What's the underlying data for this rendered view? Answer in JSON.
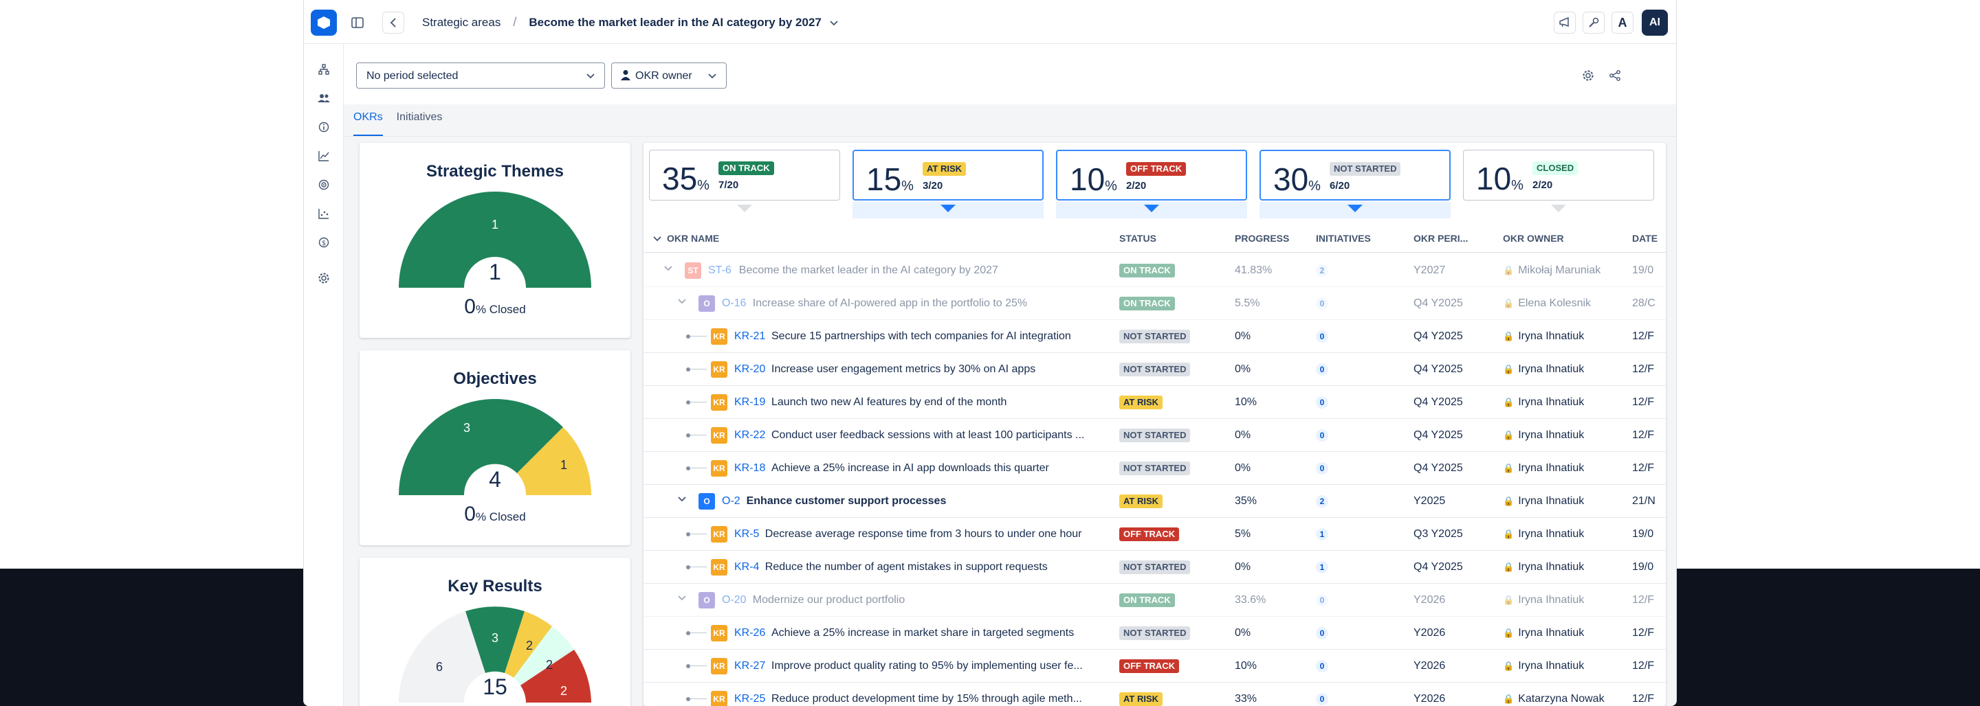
{
  "breadcrumb": {
    "parent": "Strategic areas",
    "current": "Become the market leader in the AI category by 2027"
  },
  "topbar": {
    "avatar_text": "AI",
    "font_icon_text": "A"
  },
  "filters": {
    "period": "No period selected",
    "owner": "OKR owner"
  },
  "tabs": [
    {
      "label": "OKRs"
    },
    {
      "label": "Initiatives"
    }
  ],
  "panels": {
    "themes": {
      "title": "Strategic Themes",
      "total": "1",
      "closed_value": "0",
      "closed_label": "% Closed",
      "segments": [
        {
          "label": "1",
          "value": 1,
          "color": "#1f845a"
        }
      ]
    },
    "objectives": {
      "title": "Objectives",
      "total": "4",
      "closed_value": "0",
      "closed_label": "% Closed",
      "segments": [
        {
          "label": "3",
          "value": 3,
          "color": "#1f845a"
        },
        {
          "label": "1",
          "value": 1,
          "color": "#f5cd47"
        }
      ]
    },
    "key_results": {
      "title": "Key Results",
      "total": "15",
      "segment_labels": [
        "6",
        "3",
        "2",
        "2",
        "2"
      ]
    }
  },
  "stats": [
    {
      "value": "35",
      "unit": "%",
      "badge": "ON TRACK",
      "fraction": "7/20"
    },
    {
      "value": "15",
      "unit": "%",
      "badge": "AT RISK",
      "fraction": "3/20"
    },
    {
      "value": "10",
      "unit": "%",
      "badge": "OFF TRACK",
      "fraction": "2/20"
    },
    {
      "value": "30",
      "unit": "%",
      "badge": "NOT STARTED",
      "fraction": "6/20"
    },
    {
      "value": "10",
      "unit": "%",
      "badge": "CLOSED",
      "fraction": "2/20"
    }
  ],
  "table": {
    "headers": {
      "name": "OKR NAME",
      "status": "STATUS",
      "progress": "PROGRESS",
      "initiatives": "INITIATIVES",
      "period": "OKR PERI...",
      "owner": "OKR OWNER",
      "date": "DATE"
    },
    "rows": [
      {
        "type": "ST",
        "id": "ST-6",
        "name": "Become the market leader in the AI category by 2027",
        "status": "ON TRACK",
        "progress": "41.83%",
        "initiatives": "2",
        "period": "Y2027",
        "owner": "Mikołaj Maruniak",
        "date": "19/0"
      },
      {
        "type": "O",
        "id": "O-16",
        "name": "Increase share of AI-powered app in the portfolio to 25%",
        "status": "ON TRACK",
        "progress": "5.5%",
        "initiatives": "0",
        "period": "Q4 Y2025",
        "owner": "Elena Kolesnik",
        "date": "28/C"
      },
      {
        "type": "KR",
        "id": "KR-21",
        "name": "Secure 15 partnerships with tech companies for AI integration",
        "status": "NOT STARTED",
        "progress": "0%",
        "initiatives": "0",
        "period": "Q4 Y2025",
        "owner": "Iryna Ihnatiuk",
        "date": "12/F"
      },
      {
        "type": "KR",
        "id": "KR-20",
        "name": "Increase user engagement metrics by 30% on AI apps",
        "status": "NOT STARTED",
        "progress": "0%",
        "initiatives": "0",
        "period": "Q4 Y2025",
        "owner": "Iryna Ihnatiuk",
        "date": "12/F"
      },
      {
        "type": "KR",
        "id": "KR-19",
        "name": "Launch two new AI features by end of the month",
        "status": "AT RISK",
        "progress": "10%",
        "initiatives": "0",
        "period": "Q4 Y2025",
        "owner": "Iryna Ihnatiuk",
        "date": "12/F"
      },
      {
        "type": "KR",
        "id": "KR-22",
        "name": "Conduct user feedback sessions with at least 100 participants ...",
        "status": "NOT STARTED",
        "progress": "0%",
        "initiatives": "0",
        "period": "Q4 Y2025",
        "owner": "Iryna Ihnatiuk",
        "date": "12/F"
      },
      {
        "type": "KR",
        "id": "KR-18",
        "name": "Achieve a 25% increase in AI app downloads this quarter",
        "status": "NOT STARTED",
        "progress": "0%",
        "initiatives": "0",
        "period": "Q4 Y2025",
        "owner": "Iryna Ihnatiuk",
        "date": "12/F"
      },
      {
        "type": "O",
        "id": "O-2",
        "name": "Enhance customer support processes",
        "status": "AT RISK",
        "progress": "35%",
        "initiatives": "2",
        "period": "Y2025",
        "owner": "Iryna Ihnatiuk",
        "date": "21/N"
      },
      {
        "type": "KR",
        "id": "KR-5",
        "name": "Decrease average response time from 3 hours to under one hour",
        "status": "OFF TRACK",
        "progress": "5%",
        "initiatives": "1",
        "period": "Q3 Y2025",
        "owner": "Iryna Ihnatiuk",
        "date": "19/0"
      },
      {
        "type": "KR",
        "id": "KR-4",
        "name": "Reduce the number of agent mistakes in support requests",
        "status": "NOT STARTED",
        "progress": "0%",
        "initiatives": "1",
        "period": "Q4 Y2025",
        "owner": "Iryna Ihnatiuk",
        "date": "19/0"
      },
      {
        "type": "O",
        "id": "O-20",
        "name": "Modernize our product portfolio",
        "status": "ON TRACK",
        "progress": "33.6%",
        "initiatives": "0",
        "period": "Y2026",
        "owner": "Iryna Ihnatiuk",
        "date": "12/F"
      },
      {
        "type": "KR",
        "id": "KR-26",
        "name": "Achieve a 25% increase in market share in targeted segments",
        "status": "NOT STARTED",
        "progress": "0%",
        "initiatives": "0",
        "period": "Y2026",
        "owner": "Iryna Ihnatiuk",
        "date": "12/F"
      },
      {
        "type": "KR",
        "id": "KR-27",
        "name": "Improve product quality rating to 95% by implementing user fe...",
        "status": "OFF TRACK",
        "progress": "10%",
        "initiatives": "0",
        "period": "Y2026",
        "owner": "Iryna Ihnatiuk",
        "date": "12/F"
      },
      {
        "type": "KR",
        "id": "KR-25",
        "name": "Reduce product development time by 15% through agile meth...",
        "status": "AT RISK",
        "progress": "33%",
        "initiatives": "0",
        "period": "Y2026",
        "owner": "Katarzyna Nowak",
        "date": "12/F"
      }
    ]
  },
  "colors": {
    "accent": "#0c66e4",
    "on_track": "#1f845a",
    "at_risk": "#f5cd47",
    "off_track": "#c9372c",
    "closed": "#dcfff1",
    "not_started": "#dcdfe4"
  }
}
